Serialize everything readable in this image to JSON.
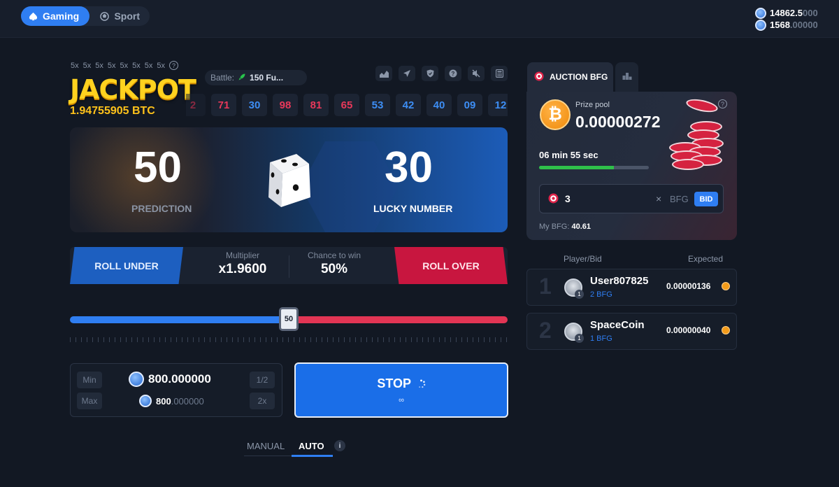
{
  "topbar": {
    "tabs": [
      {
        "label": "Gaming",
        "icon": "spade-icon",
        "active": true
      },
      {
        "label": "Sport",
        "icon": "ball-icon",
        "active": false
      }
    ],
    "wallet": [
      {
        "main": "14862.5",
        "dim": "000",
        "coin": "raccoon-coin-icon"
      },
      {
        "main": "1568",
        "dim": ".00000",
        "coin": "raccoon-coin-icon"
      }
    ]
  },
  "jackpot": {
    "multipliers": [
      "5x",
      "5x",
      "5x",
      "5x",
      "5x",
      "5x",
      "5x",
      "5x"
    ],
    "title": "JACKPOT",
    "value": "1.94755905 BTC"
  },
  "battle": {
    "label": "Battle:",
    "value": "150 Fu..."
  },
  "history": [
    {
      "v": "2",
      "color": "red"
    },
    {
      "v": "71",
      "color": "red"
    },
    {
      "v": "30",
      "color": "blue"
    },
    {
      "v": "98",
      "color": "red"
    },
    {
      "v": "81",
      "color": "red"
    },
    {
      "v": "65",
      "color": "red"
    },
    {
      "v": "53",
      "color": "blue"
    },
    {
      "v": "42",
      "color": "blue"
    },
    {
      "v": "40",
      "color": "blue"
    },
    {
      "v": "09",
      "color": "blue"
    },
    {
      "v": "12",
      "color": "blue"
    }
  ],
  "dice": {
    "prediction": "50",
    "prediction_label": "PREDICTION",
    "lucky_number": "30",
    "lucky_label": "LUCKY NUMBER"
  },
  "controls": {
    "roll_under": "ROLL UNDER",
    "roll_over": "ROLL OVER",
    "multiplier_label": "Multiplier",
    "multiplier_value": "x1.9600",
    "chance_label": "Chance to win",
    "chance_value": "50%"
  },
  "slider": {
    "value": "50",
    "fraction": 0.5
  },
  "bet": {
    "min_label": "Min",
    "max_label": "Max",
    "half_label": "1/2",
    "double_label": "2x",
    "amount": "800.000000",
    "max_main": "800",
    "max_dim": ".000000"
  },
  "stop": {
    "label": "STOP",
    "sub": "∞"
  },
  "modes": {
    "manual": "MANUAL",
    "auto": "AUTO",
    "info": "i"
  },
  "auction": {
    "tab_label": "AUCTION BFG",
    "prize_label": "Prize pool",
    "prize_value": "0.00000272",
    "btc_symbol": "₿",
    "timer": "06 min 55 sec",
    "timer_progress": 0.68,
    "bid_value": "3",
    "bid_clear": "×",
    "bid_unit": "BFG",
    "bid_button": "BID",
    "my_bfg_label": "My BFG:",
    "my_bfg_value": "40.61"
  },
  "leaderboard": {
    "header_player": "Player/Bid",
    "header_expected": "Expected",
    "rows": [
      {
        "rank": "1",
        "name": "User807825",
        "bid": "2 BFG",
        "expected": "0.00000136",
        "level": "1"
      },
      {
        "rank": "2",
        "name": "SpaceCoin",
        "bid": "1 BFG",
        "expected": "0.00000040",
        "level": "1"
      }
    ]
  },
  "colors": {
    "accent": "#2f7ef2",
    "red": "#e23554",
    "gold": "#ffd21f",
    "bg": "#121823"
  }
}
